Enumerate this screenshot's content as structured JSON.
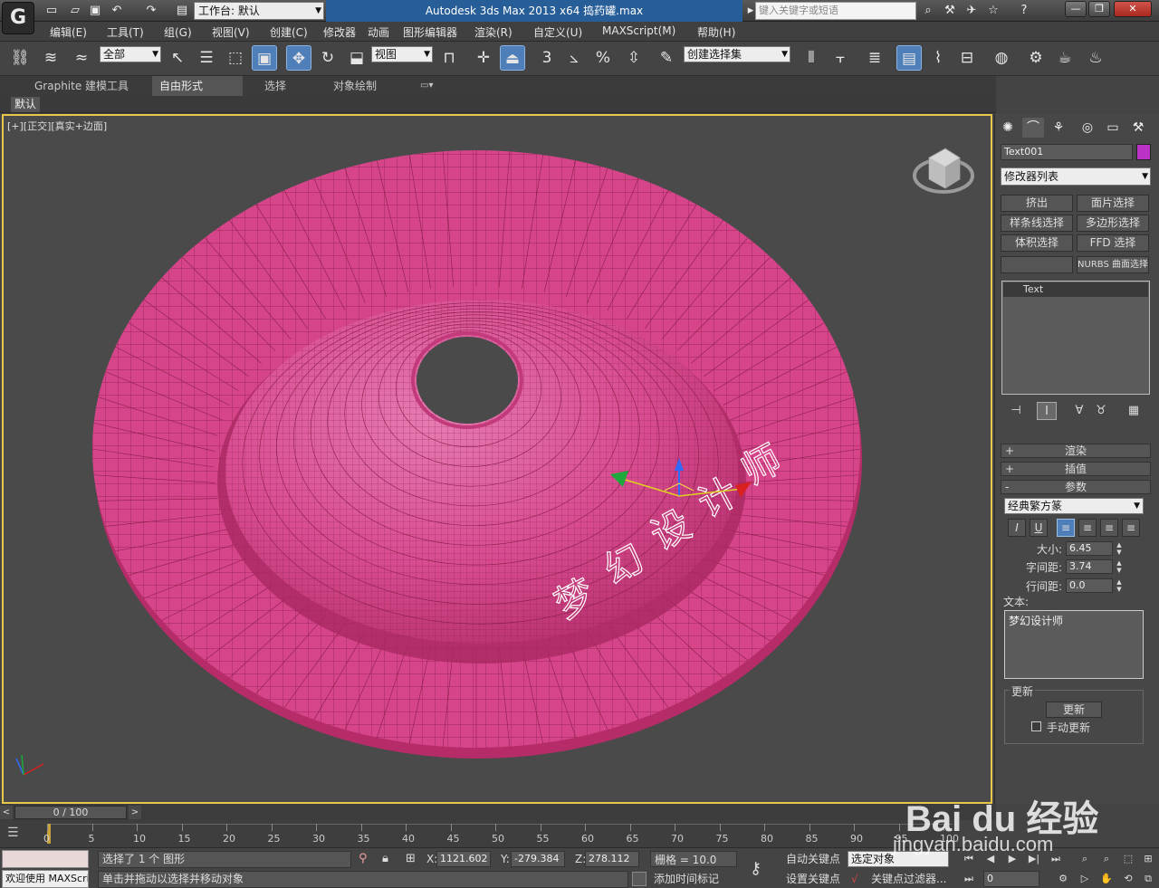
{
  "titlebar": {
    "workspace_label": "工作台: 默认",
    "title": "Autodesk 3ds Max  2013 x64      捣药罐.max",
    "search_placeholder": "键入关键字或短语"
  },
  "menu": {
    "items": [
      "编辑(E)",
      "工具(T)",
      "组(G)",
      "视图(V)",
      "创建(C)",
      "修改器",
      "动画",
      "图形编辑器",
      "渲染(R)",
      "自定义(U)",
      "MAXScript(M)",
      "帮助(H)"
    ]
  },
  "toolbar": {
    "filter_value": "全部",
    "refcoord_value": "视图",
    "named_selection_value": "创建选择集",
    "snap_3_label": "3",
    "percent_label": "%"
  },
  "ribbon": {
    "tabs": [
      "Graphite 建模工具",
      "自由形式",
      "选择",
      "对象绘制"
    ],
    "default_label": "默认"
  },
  "viewport": {
    "label": "[+][正交][真实+边面]",
    "text_object_chars": "梦幻设计师",
    "mesh_color": "#d6458a",
    "wire_color": "#8a1e4a",
    "highlight_color": "#e06aa4"
  },
  "command_panel": {
    "object_name": "Text001",
    "object_color": "#bc32c6",
    "modifier_list": "修改器列表",
    "modifier_buttons": [
      "挤出",
      "面片选择",
      "样条线选择",
      "多边形选择",
      "体积选择",
      "FFD 选择",
      "",
      "NURBS 曲面选择"
    ],
    "stack_item": "Text",
    "rollouts": {
      "render": "渲染",
      "interp": "插值",
      "params": "参数"
    },
    "font": "经典繁方篆",
    "format_buttons": [
      "I",
      "U",
      "≡",
      "≡",
      "≡",
      "≡"
    ],
    "size_label": "大小:",
    "size_value": "6.45",
    "kerning_label": "字间距:",
    "kerning_value": "3.74",
    "leading_label": "行间距:",
    "leading_value": "0.0",
    "text_label": "文本:",
    "text_value": "梦幻设计师",
    "update_group": "更新",
    "update_button": "更新",
    "manual_update": "手动更新"
  },
  "timeline": {
    "slider": "0 / 100",
    "ticks": [
      "0",
      "5",
      "10",
      "15",
      "20",
      "25",
      "30",
      "35",
      "40",
      "45",
      "50",
      "55",
      "60",
      "65",
      "70",
      "75",
      "80",
      "85",
      "90",
      "95",
      "100"
    ]
  },
  "status": {
    "welcome": "欢迎使用 MAXScri",
    "selection": "选择了 1 个 图形",
    "prompt": "单击并拖动以选择并移动对象",
    "x_label": "X:",
    "x_value": "1121.602",
    "y_label": "Y:",
    "y_value": "-279.384",
    "z_label": "Z:",
    "z_value": "278.112",
    "grid": "栅格 = 10.0",
    "add_time_tag": "添加时间标记",
    "auto_key": "自动关键点",
    "set_key": "设置关键点",
    "key_filter_combo": "选定对象",
    "key_filters": "关键点过滤器...",
    "frame": "0"
  },
  "watermark": {
    "brand": "Bai du 经验",
    "url": "jingyan.baidu.com"
  }
}
